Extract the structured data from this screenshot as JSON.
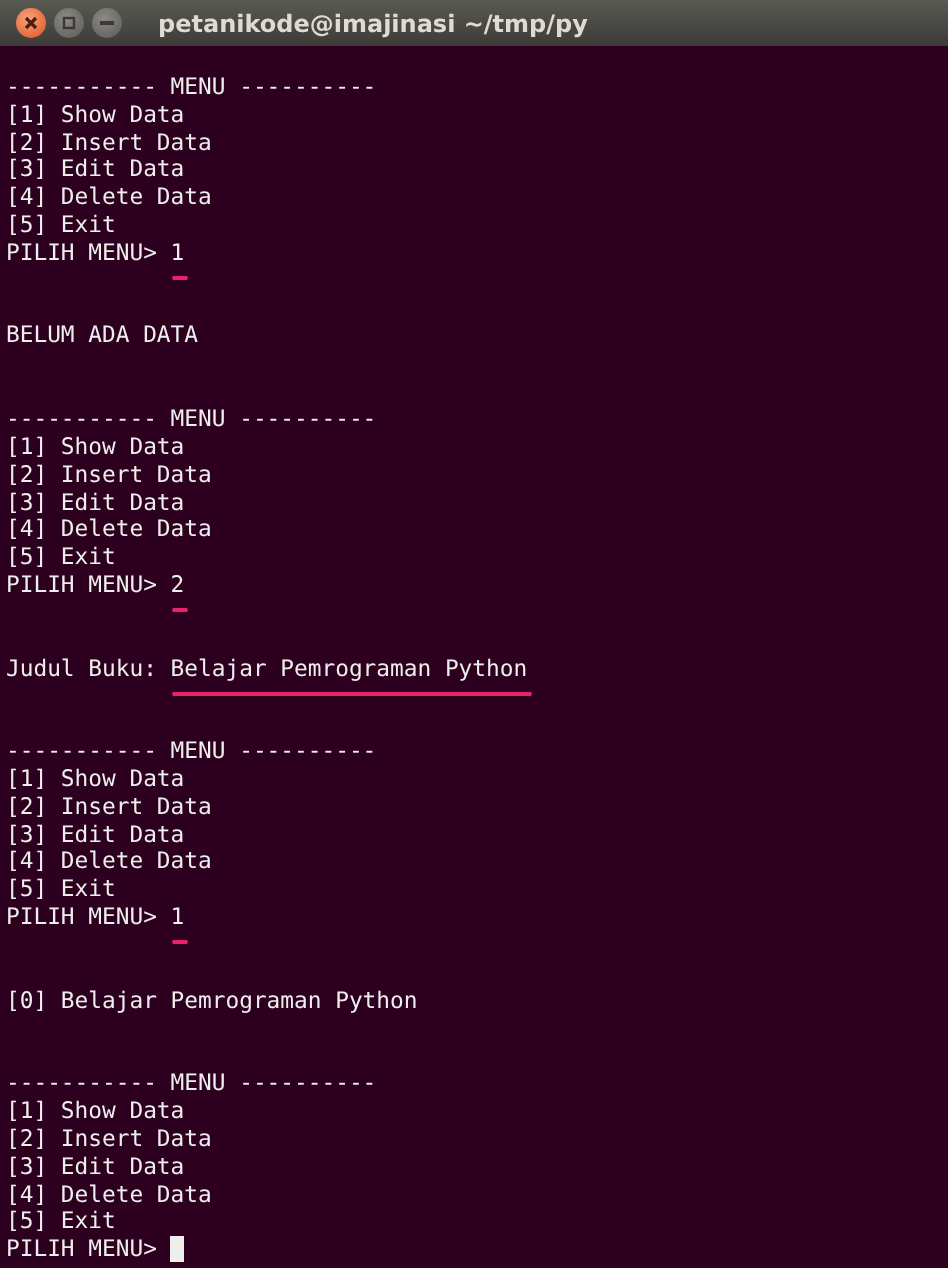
{
  "window": {
    "title": "petanikode@imajinasi ~/tmp/py"
  },
  "terminal": {
    "lines": [
      {
        "kind": "blank"
      },
      {
        "kind": "text",
        "text": "----------- MENU ----------"
      },
      {
        "kind": "text",
        "text": "[1] Show Data"
      },
      {
        "kind": "text",
        "text": "[2] Insert Data"
      },
      {
        "kind": "text",
        "text": "[3] Edit Data"
      },
      {
        "kind": "text",
        "text": "[4] Delete Data"
      },
      {
        "kind": "text",
        "text": "[5] Exit"
      },
      {
        "kind": "prompt",
        "text": "PILIH MENU> ",
        "input": "1",
        "underlined": true
      },
      {
        "kind": "blank"
      },
      {
        "kind": "blank"
      },
      {
        "kind": "text",
        "text": "BELUM ADA DATA"
      },
      {
        "kind": "blank"
      },
      {
        "kind": "blank"
      },
      {
        "kind": "text",
        "text": "----------- MENU ----------"
      },
      {
        "kind": "text",
        "text": "[1] Show Data"
      },
      {
        "kind": "text",
        "text": "[2] Insert Data"
      },
      {
        "kind": "text",
        "text": "[3] Edit Data"
      },
      {
        "kind": "text",
        "text": "[4] Delete Data"
      },
      {
        "kind": "text",
        "text": "[5] Exit"
      },
      {
        "kind": "prompt",
        "text": "PILIH MENU> ",
        "input": "2",
        "underlined": true
      },
      {
        "kind": "blank"
      },
      {
        "kind": "blank"
      },
      {
        "kind": "prompt",
        "text": "Judul Buku: ",
        "input": "Belajar Pemrograman Python",
        "underlined": true
      },
      {
        "kind": "blank"
      },
      {
        "kind": "blank"
      },
      {
        "kind": "text",
        "text": "----------- MENU ----------"
      },
      {
        "kind": "text",
        "text": "[1] Show Data"
      },
      {
        "kind": "text",
        "text": "[2] Insert Data"
      },
      {
        "kind": "text",
        "text": "[3] Edit Data"
      },
      {
        "kind": "text",
        "text": "[4] Delete Data"
      },
      {
        "kind": "text",
        "text": "[5] Exit"
      },
      {
        "kind": "prompt",
        "text": "PILIH MENU> ",
        "input": "1",
        "underlined": true
      },
      {
        "kind": "blank"
      },
      {
        "kind": "blank"
      },
      {
        "kind": "text",
        "text": "[0] Belajar Pemrograman Python"
      },
      {
        "kind": "blank"
      },
      {
        "kind": "blank"
      },
      {
        "kind": "text",
        "text": "----------- MENU ----------"
      },
      {
        "kind": "text",
        "text": "[1] Show Data"
      },
      {
        "kind": "text",
        "text": "[2] Insert Data"
      },
      {
        "kind": "text",
        "text": "[3] Edit Data"
      },
      {
        "kind": "text",
        "text": "[4] Delete Data"
      },
      {
        "kind": "text",
        "text": "[5] Exit"
      },
      {
        "kind": "prompt",
        "text": "PILIH MENU> ",
        "cursor": true
      }
    ]
  }
}
